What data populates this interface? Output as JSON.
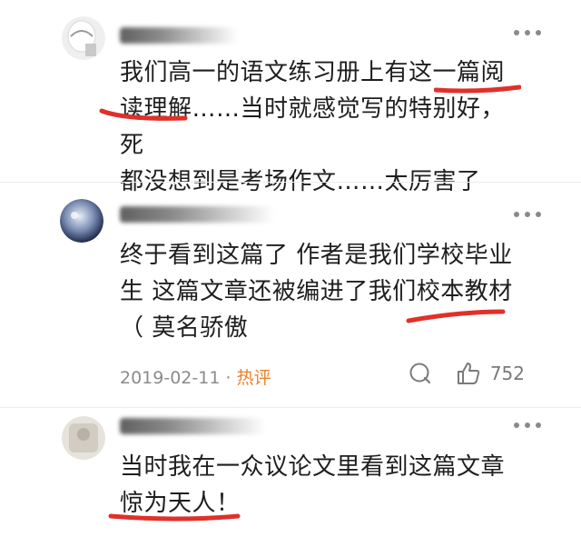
{
  "comments": [
    {
      "text": "我们高一的语文练习册上有这一篇阅\n读理解……当时就感觉写的特别好，死\n都没想到是考场作文……太厉害了"
    },
    {
      "text": "终于看到这篇了 作者是我们学校毕业\n生 这篇文章还被编进了我们校本教材\n（ 莫名骄傲",
      "date": "2019-02-11",
      "separator": "·",
      "tag": "热评",
      "like_count": "752"
    },
    {
      "text": "当时我在一众议论文里看到这篇文章\n惊为天人！"
    }
  ],
  "colors": {
    "underline": "#e0302a",
    "hot_tag": "#e8822b",
    "meta": "#8b8b8b"
  },
  "icons": [
    "more-icon",
    "comment-icon",
    "like-icon"
  ]
}
